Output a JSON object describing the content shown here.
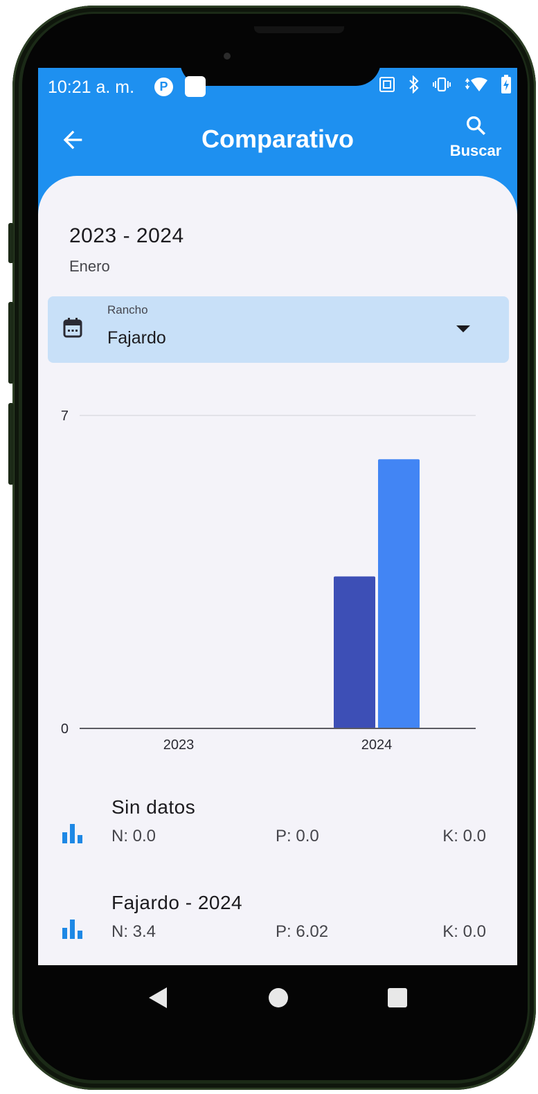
{
  "status_bar": {
    "time": "10:21 a. m.",
    "icons": [
      "notification-p-icon",
      "notification-square-icon",
      "nfc-icon",
      "bluetooth-icon",
      "vibrate-icon",
      "wifi-icon",
      "battery-charging-icon"
    ]
  },
  "app_bar": {
    "back_icon": "arrow-left-icon",
    "title": "Comparativo",
    "search_label": "Buscar"
  },
  "header": {
    "years": "2023 - 2024",
    "month": "Enero"
  },
  "ranch_select": {
    "label": "Rancho",
    "value": "Fajardo",
    "icon": "calendar-icon"
  },
  "chart_data": {
    "type": "bar",
    "categories": [
      "2023",
      "2024"
    ],
    "series": [
      {
        "values": [
          0,
          3.4
        ],
        "color": "#3d4fb6"
      },
      {
        "values": [
          0,
          6.02
        ],
        "color": "#4285f4"
      }
    ],
    "ylim": [
      0,
      7
    ],
    "yticks": [
      "0",
      "7"
    ],
    "grid": true
  },
  "results": [
    {
      "title": "Sin datos",
      "n": "N: 0.0",
      "p": "P: 0.0",
      "k": "K: 0.0"
    },
    {
      "title": "Fajardo - 2024",
      "n": "N: 3.4",
      "p": "P: 6.02",
      "k": "K: 0.0"
    }
  ],
  "colors": {
    "primary": "#1e90f0",
    "surface": "#f4f3f9",
    "dropdown_fill": "#c8e0f8"
  }
}
